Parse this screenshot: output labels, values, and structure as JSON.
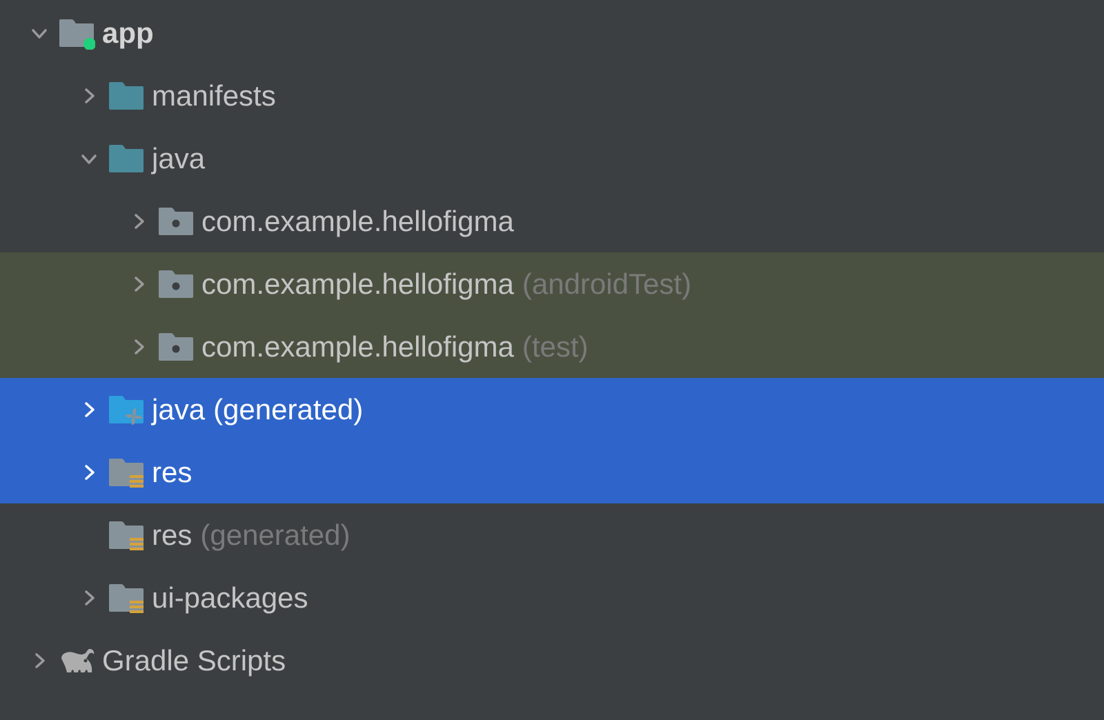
{
  "tree": {
    "app": {
      "label": "app"
    },
    "manifests": {
      "label": "manifests"
    },
    "java": {
      "label": "java"
    },
    "pkg_main": {
      "label": "com.example.hellofigma"
    },
    "pkg_androidTest": {
      "label": "com.example.hellofigma",
      "suffix": "(androidTest)"
    },
    "pkg_test": {
      "label": "com.example.hellofigma",
      "suffix": "(test)"
    },
    "java_generated": {
      "label": "java",
      "suffix": "(generated)"
    },
    "res": {
      "label": "res"
    },
    "res_generated": {
      "label": "res",
      "suffix": "(generated)"
    },
    "ui_packages": {
      "label": "ui-packages"
    },
    "gradle_scripts": {
      "label": "Gradle Scripts"
    }
  },
  "colors": {
    "folder_teal": "#4a8b9c",
    "folder_grey": "#87939a",
    "folder_blue": "#2da0dd",
    "selected_bg": "#2f65ca",
    "highlighted_bg": "#4b5141",
    "vcs_dot": "#21d07a",
    "resource_lines": "#d5a23c"
  }
}
